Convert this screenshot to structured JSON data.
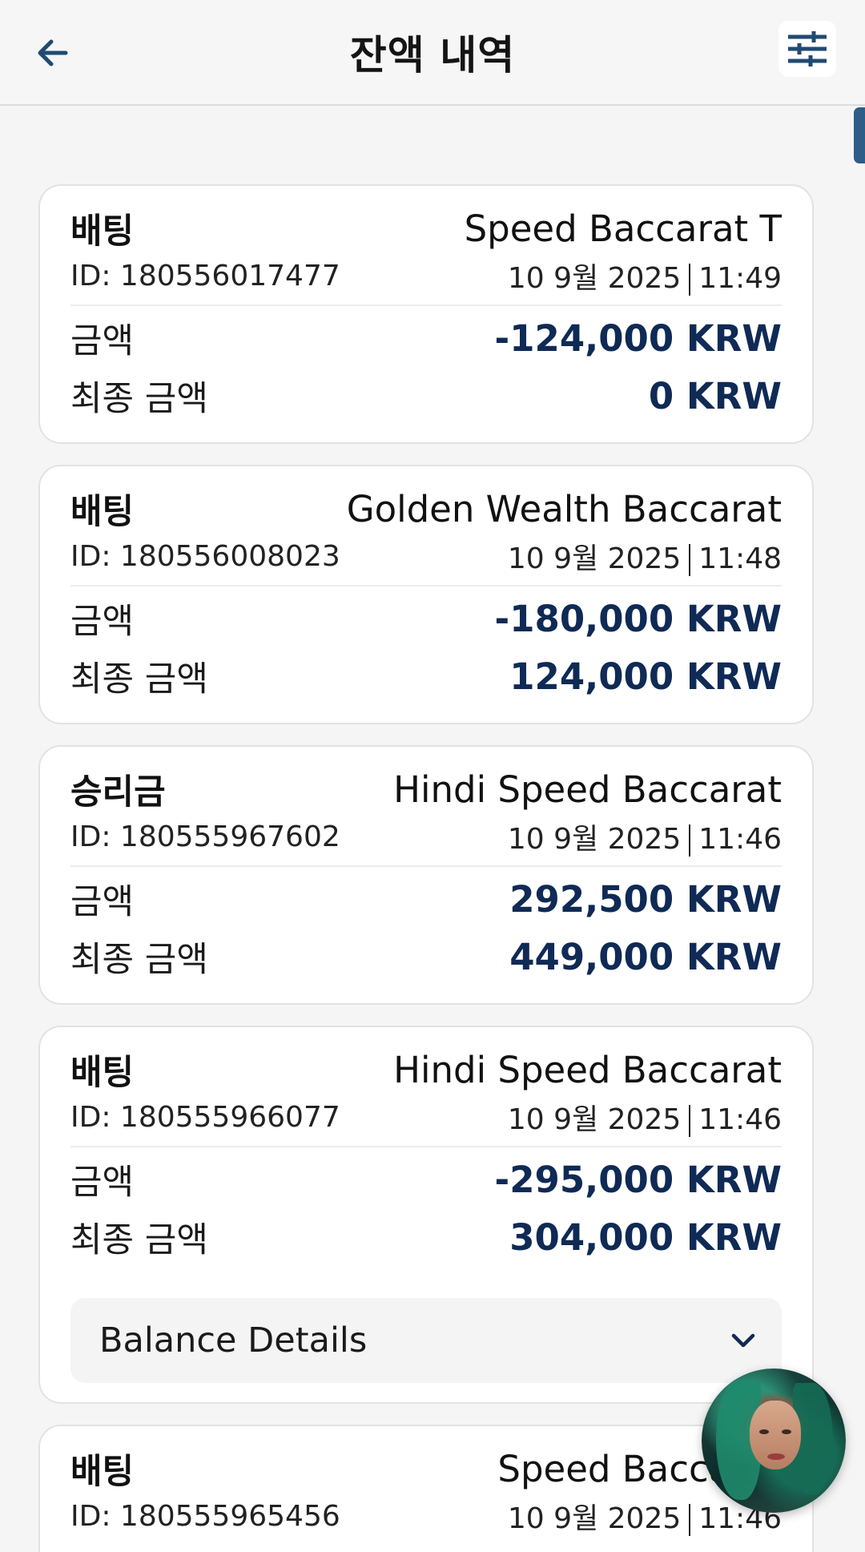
{
  "header": {
    "title": "잔액 내역",
    "back_icon": "arrow-left-icon",
    "filter_icon": "sliders-icon"
  },
  "colors": {
    "accent": "#2e5d87",
    "amount": "#0f2a55"
  },
  "transactions": [
    {
      "type": "배팅",
      "game": "Speed Baccarat T",
      "id": "ID: 180556017477",
      "date": "10 9월 2025",
      "time": "11:49",
      "amount_label": "금액",
      "amount": "-124,000 KRW",
      "final_label": "최종 금액",
      "final": "0 KRW"
    },
    {
      "type": "배팅",
      "game": "Golden Wealth Baccarat",
      "id": "ID: 180556008023",
      "date": "10 9월 2025",
      "time": "11:48",
      "amount_label": "금액",
      "amount": "-180,000 KRW",
      "final_label": "최종 금액",
      "final": "124,000 KRW"
    },
    {
      "type": "승리금",
      "game": "Hindi Speed Baccarat",
      "id": "ID: 180555967602",
      "date": "10 9월 2025",
      "time": "11:46",
      "amount_label": "금액",
      "amount": "292,500 KRW",
      "final_label": "최종 금액",
      "final": "449,000 KRW"
    },
    {
      "type": "배팅",
      "game": "Hindi Speed Baccarat",
      "id": "ID: 180555966077",
      "date": "10 9월 2025",
      "time": "11:46",
      "amount_label": "금액",
      "amount": "-295,000 KRW",
      "final_label": "최종 금액",
      "final": "304,000 KRW",
      "details_label": "Balance Details"
    },
    {
      "type": "배팅",
      "game": "Speed Baccarat",
      "id": "ID: 180555965456",
      "date": "10 9월 2025",
      "time": "11:46"
    }
  ],
  "support_avatar": "avatar"
}
